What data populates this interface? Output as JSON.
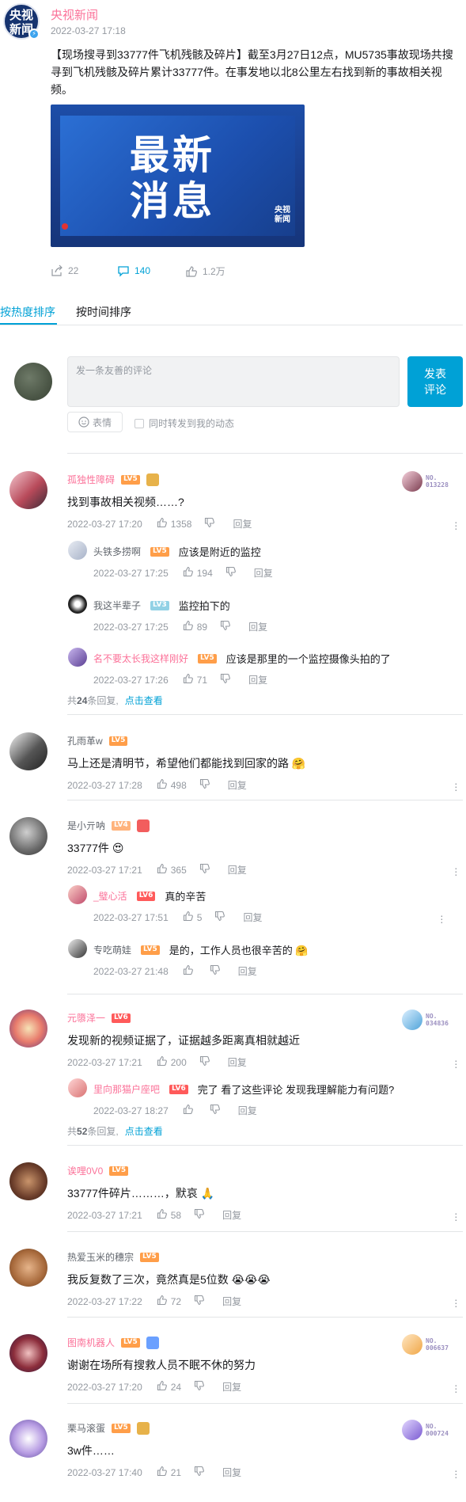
{
  "post": {
    "avatar_text_1": "央视",
    "avatar_text_2": "新闻",
    "author": "央视新闻",
    "time": "2022-03-27 17:18",
    "text": "【现场搜寻到33777件飞机残骸及碎片】截至3月27日12点，MU5735事故现场共搜寻到飞机残骸及碎片累计33777件。在事发地以北8公里左右找到新的事故相关视频。",
    "image": {
      "line1": "最新",
      "line2": "消息",
      "logo_1": "央视",
      "logo_2": "新闻"
    },
    "stats": {
      "forward": "22",
      "comments": "140",
      "likes": "1.2万"
    }
  },
  "tabs": [
    {
      "label": "按热度排序"
    },
    {
      "label": "按时间排序"
    }
  ],
  "composer": {
    "placeholder": "发一条友善的评论",
    "post_label_1": "发表",
    "post_label_2": "评论",
    "emoji_label": "表情",
    "forward_label": "同时转发到我的动态"
  },
  "comments": [
    {
      "user": "孤独性障碍",
      "level": "LV5",
      "text": "找到事故相关视频……?",
      "time": "2022-03-27 17:20",
      "likes": "1358",
      "reply_label": "回复",
      "fan_no": "NO.",
      "fan_num": "013228",
      "replies": [
        {
          "user": "头铁多捞啊",
          "level": "LV5",
          "text": "应该是附近的监控",
          "time": "2022-03-27 17:25",
          "likes": "194",
          "reply_label": "回复"
        },
        {
          "user": "我这半辈子",
          "level": "LV3",
          "text": "监控拍下的",
          "time": "2022-03-27 17:25",
          "likes": "89",
          "reply_label": "回复"
        },
        {
          "user": "名不要太长我这样刚好",
          "level": "LV5",
          "text": "应该是那里的一个监控摄像头拍的了",
          "time": "2022-03-27 17:26",
          "likes": "71",
          "reply_label": "回复"
        }
      ],
      "more_prefix": "共",
      "more_count": "24",
      "more_suffix": "条回复,",
      "more_link": "点击查看"
    },
    {
      "user": "孔雨革w",
      "level": "LV5",
      "text": "马上还是清明节，希望他们都能找到回家的路 🤗",
      "time": "2022-03-27 17:28",
      "likes": "498",
      "reply_label": "回复"
    },
    {
      "user": "是小亓呐",
      "level": "LV4",
      "text": "33777件 😍",
      "time": "2022-03-27 17:21",
      "likes": "365",
      "reply_label": "回复",
      "replies": [
        {
          "user": "_璧心活",
          "level": "LV6",
          "text": "真的辛苦",
          "time": "2022-03-27 17:51",
          "likes": "5",
          "reply_label": "回复"
        },
        {
          "user": "专吃萌娃",
          "level": "LV5",
          "text": "是的，工作人员也很辛苦的 🤗",
          "time": "2022-03-27 21:48",
          "likes": "",
          "reply_label": "回复"
        }
      ]
    },
    {
      "user": "元隳泽一",
      "level": "LV6",
      "text": "发现新的视频证据了，证据越多距离真相就越近",
      "time": "2022-03-27 17:21",
      "likes": "200",
      "reply_label": "回复",
      "fan_no": "NO.",
      "fan_num": "034836",
      "replies": [
        {
          "user": "里向那猫户座吧",
          "level": "LV6",
          "text": "完了 看了这些评论 发现我理解能力有问题?",
          "time": "2022-03-27 18:27",
          "likes": "",
          "reply_label": "回复"
        }
      ],
      "more_prefix": "共",
      "more_count": "52",
      "more_suffix": "条回复,",
      "more_link": "点击查看"
    },
    {
      "user": "诶哩0V0",
      "level": "LV5",
      "text": "33777件碎片………，默哀 🙏",
      "time": "2022-03-27 17:21",
      "likes": "58",
      "reply_label": "回复"
    },
    {
      "user": "热爱玉米的穗宗",
      "level": "LV5",
      "text": "我反复数了三次，竟然真是5位数 😭😭😭",
      "time": "2022-03-27 17:22",
      "likes": "72",
      "reply_label": "回复"
    },
    {
      "user": "图南机器人",
      "level": "LV5",
      "text": "谢谢在场所有搜救人员不眠不休的努力",
      "time": "2022-03-27 17:20",
      "likes": "24",
      "reply_label": "回复",
      "fan_no": "NO.",
      "fan_num": "006637"
    },
    {
      "user": "栗马滚蛋",
      "level": "LV5",
      "text": "3w件……",
      "time": "2022-03-27 17:40",
      "likes": "21",
      "reply_label": "回复",
      "fan_no": "NO.",
      "fan_num": "000724"
    }
  ],
  "colors": {
    "accent": "#00a1d6",
    "vip_name": "#fb7299",
    "meta": "#9499a0"
  }
}
